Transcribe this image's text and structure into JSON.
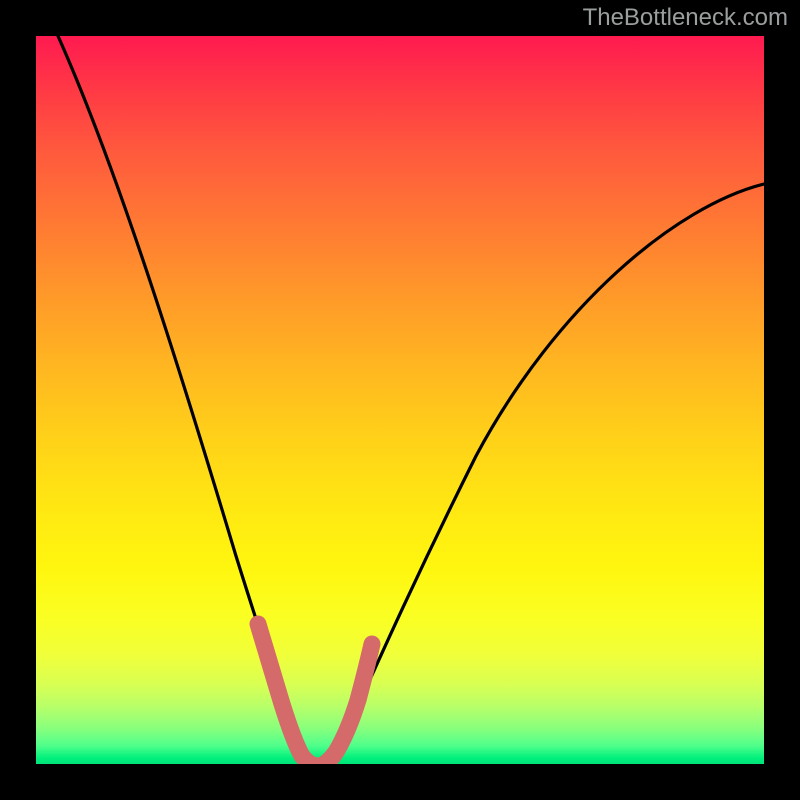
{
  "watermark": "TheBottleneck.com",
  "chart_data": {
    "type": "line",
    "title": "",
    "xlabel": "",
    "ylabel": "",
    "xlim": [
      0,
      100
    ],
    "ylim": [
      0,
      100
    ],
    "grid": false,
    "legend": false,
    "gradient_bands": [
      {
        "name": "red",
        "approx_range_pct": [
          0,
          20
        ]
      },
      {
        "name": "orange",
        "approx_range_pct": [
          20,
          50
        ]
      },
      {
        "name": "yellow",
        "approx_range_pct": [
          50,
          90
        ]
      },
      {
        "name": "green",
        "approx_range_pct": [
          90,
          100
        ]
      }
    ],
    "series": [
      {
        "name": "bottleneck-curve",
        "note": "y = bottleneck percentage (100 top, 0 bottom); x = relative component position",
        "x": [
          3,
          8,
          12,
          16,
          20,
          24,
          27,
          30,
          32,
          34,
          35.5,
          37.5,
          39.5,
          42,
          46,
          52,
          60,
          70,
          82,
          95,
          100
        ],
        "y": [
          100,
          86,
          74,
          63,
          52,
          41,
          31,
          21,
          13,
          6,
          2,
          0.5,
          2,
          6,
          14,
          25,
          39,
          53,
          66,
          77,
          80
        ]
      },
      {
        "name": "optimal-marker",
        "note": "thick coral segment around minimum",
        "x": [
          30,
          31,
          32,
          33,
          34,
          35,
          36,
          37,
          38,
          39,
          40,
          41,
          42,
          43
        ],
        "y": [
          19,
          15,
          12,
          8,
          5,
          3,
          2,
          2,
          3,
          5,
          8,
          10,
          13,
          15
        ]
      }
    ],
    "minimum_at_x_pct": 37
  }
}
